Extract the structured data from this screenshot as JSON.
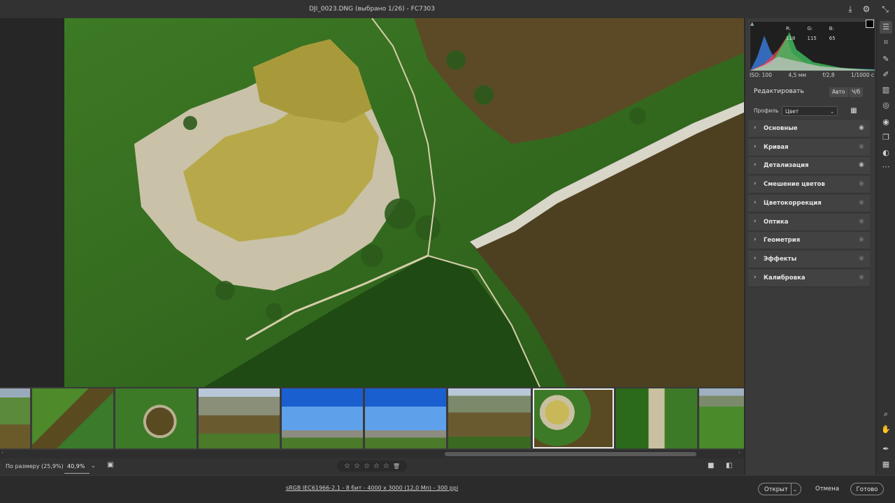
{
  "window": {
    "title": "DJI_0023.DNG (выбрано 1/26)  -  FC7303"
  },
  "histogram": {
    "r_label": "R: 118",
    "g_label": "G: 115",
    "b_label": "B: 65"
  },
  "camera_info": {
    "iso": "ISO: 100",
    "focal": "4,5 мм",
    "aperture": "f/2,8",
    "shutter": "1/1000 с"
  },
  "edit_panel": {
    "title": "Редактировать",
    "auto_label": "Авто",
    "bw_label": "Ч/б",
    "profile_label": "Профиль",
    "profile_value": "Цвет",
    "sections": [
      {
        "label": "Основные",
        "eye_active": true
      },
      {
        "label": "Кривая",
        "eye_active": false
      },
      {
        "label": "Детализация",
        "eye_active": true
      },
      {
        "label": "Смешение цветов",
        "eye_active": false
      },
      {
        "label": "Цветокоррекция",
        "eye_active": false
      },
      {
        "label": "Оптика",
        "eye_active": false
      },
      {
        "label": "Геометрия",
        "eye_active": false
      },
      {
        "label": "Эффекты",
        "eye_active": false
      },
      {
        "label": "Калибровка",
        "eye_active": false
      }
    ]
  },
  "bottom_bar": {
    "fit_label": "По размеру (25,9%)",
    "zoom_value": "40,9%"
  },
  "status": {
    "file_info": "sRGB IEC61966-2.1 - 8 бит - 4000 x 3000 (12,0 Мп) - 300 ppi"
  },
  "footer": {
    "open_label": "Открыт",
    "cancel_label": "Отмена",
    "done_label": "Готово"
  },
  "colors": {
    "panel_bg": "#3a3a3a",
    "section_bg": "#424242",
    "app_bg": "#2b2b2b"
  }
}
